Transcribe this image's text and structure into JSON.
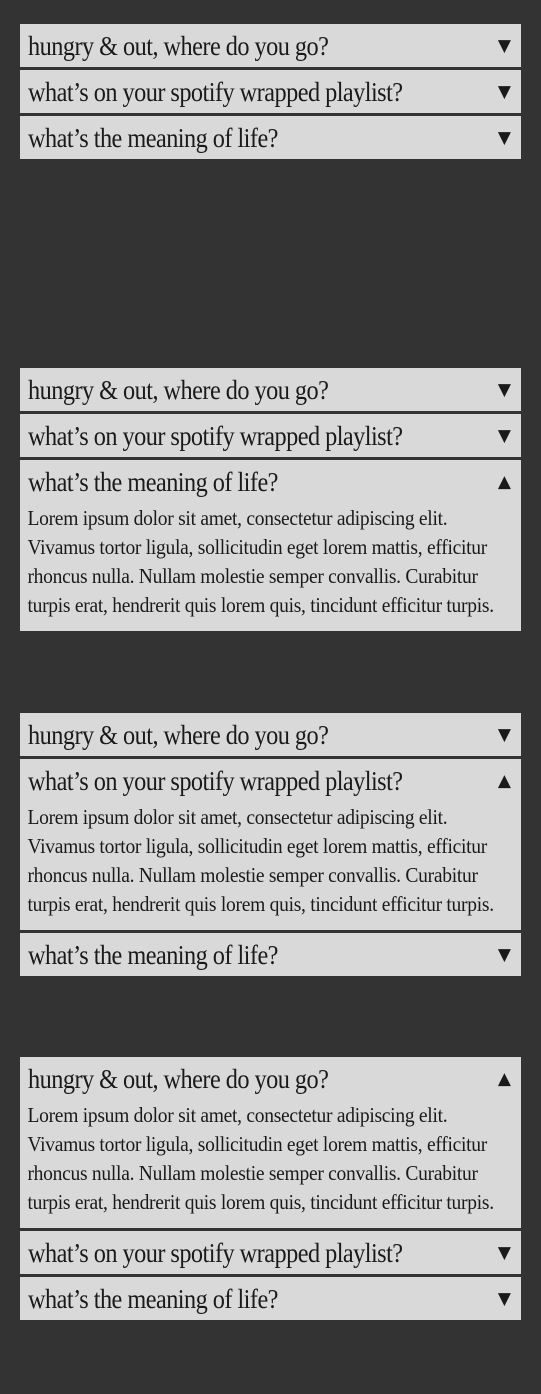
{
  "colors": {
    "background": "#333333",
    "panel": "#d9d9d9",
    "text": "#1a1a1a"
  },
  "icons": {
    "collapsed": "triangle-down-icon",
    "expanded": "triangle-up-icon",
    "down_glyph": "▼",
    "up_glyph": "▲"
  },
  "accordions": [
    {
      "items": [
        {
          "question": "hungry & out, where do you go?",
          "expanded": false
        },
        {
          "question": "what’s on your spotify wrapped playlist?",
          "expanded": false
        },
        {
          "question": "what’s the meaning of life?",
          "expanded": false
        }
      ]
    },
    {
      "items": [
        {
          "question": "hungry & out, where do you go?",
          "expanded": false
        },
        {
          "question": "what’s on your spotify wrapped playlist?",
          "expanded": false
        },
        {
          "question": "what’s the meaning of life?",
          "expanded": true,
          "answer": "Lorem ipsum dolor sit amet, consectetur adipiscing elit. Vivamus tortor ligula, sollicitudin eget lorem mattis, efficitur rhoncus nulla. Nullam molestie semper convallis. Curabitur turpis erat, hendrerit quis lorem quis, tincidunt efficitur turpis."
        }
      ]
    },
    {
      "items": [
        {
          "question": "hungry & out, where do you go?",
          "expanded": false
        },
        {
          "question": "what’s on your spotify wrapped playlist?",
          "expanded": true,
          "answer": "Lorem ipsum dolor sit amet, consectetur adipiscing elit. Vivamus tortor ligula, sollicitudin eget lorem mattis, efficitur rhoncus nulla. Nullam molestie semper convallis. Curabitur turpis erat, hendrerit quis lorem quis, tincidunt efficitur turpis."
        },
        {
          "question": "what’s the meaning of life?",
          "expanded": false
        }
      ]
    },
    {
      "items": [
        {
          "question": "hungry & out, where do you go?",
          "expanded": true,
          "answer": "Lorem ipsum dolor sit amet, consectetur adipiscing elit. Vivamus tortor ligula, sollicitudin eget lorem mattis, efficitur rhoncus nulla. Nullam molestie semper convallis. Curabitur turpis erat, hendrerit quis lorem quis, tincidunt efficitur turpis."
        },
        {
          "question": "what’s on your spotify wrapped playlist?",
          "expanded": false
        },
        {
          "question": "what’s the meaning of life?",
          "expanded": false
        }
      ]
    }
  ]
}
